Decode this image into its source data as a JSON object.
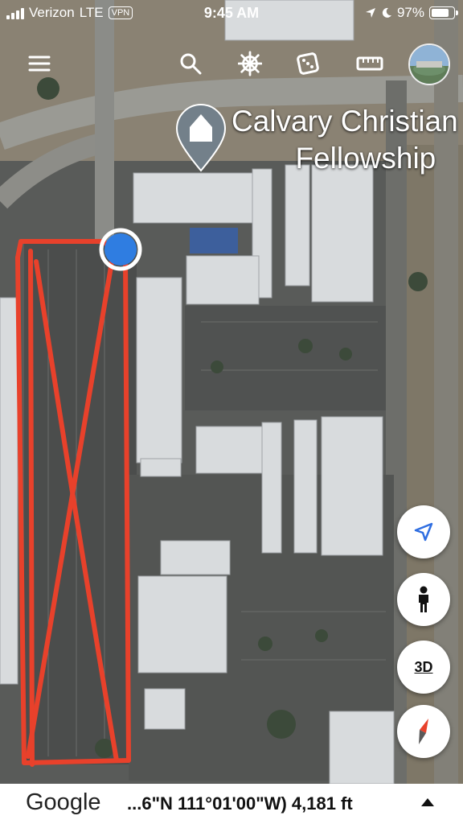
{
  "status_bar": {
    "carrier": "Verizon",
    "network": "LTE",
    "vpn": "VPN",
    "time": "9:45 AM",
    "battery_percent": "97%",
    "battery_level": 0.97,
    "icons": [
      "signal-bars-icon",
      "location-arrow-icon",
      "moon-icon",
      "battery-icon"
    ]
  },
  "toolbar": {
    "icons": [
      "menu-icon",
      "search-icon",
      "voyager-wheel-icon",
      "dice-icon",
      "ruler-icon",
      "profile-avatar"
    ]
  },
  "map": {
    "place_name_line1": "Calvary Christian",
    "place_name_line2": "Fellowship",
    "place_pin_icon": "church-pin-icon",
    "location_dot_color": "#2f7de1",
    "annotation_color": "#e8412b"
  },
  "controls": {
    "three_d_label": "3D",
    "icons": [
      "my-location-icon",
      "street-view-pegman-icon",
      "compass-icon"
    ]
  },
  "bottom_bar": {
    "brand": "Google",
    "coordinates": "...6\"N 111°01'00\"W) 4,181 ft"
  }
}
